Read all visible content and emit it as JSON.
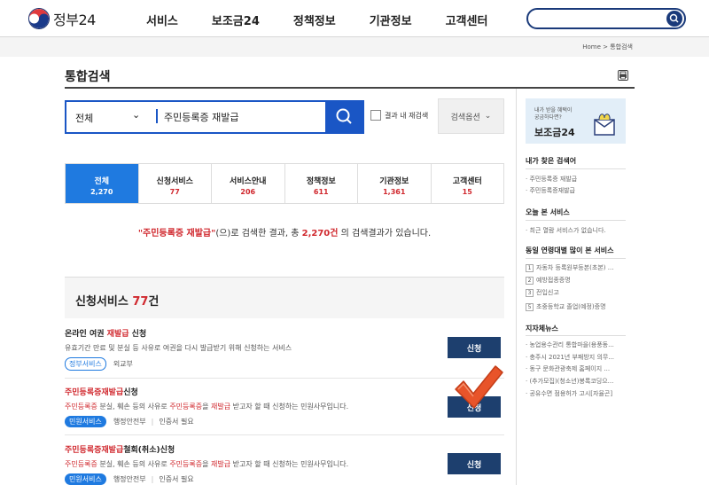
{
  "header": {
    "logo_text": "정부24",
    "menu": [
      "서비스",
      "보조금24",
      "정책정보",
      "기관정보",
      "고객센터"
    ],
    "search_placeholder": ""
  },
  "breadcrumb": {
    "home": "Home",
    "sep": ">",
    "current": "통합검색"
  },
  "page_title": "통합검색",
  "search": {
    "scope": "전체",
    "query": "주민등록증 재발급",
    "in_result_label": "결과 내 재검색",
    "options_label": "검색옵션"
  },
  "tabs": [
    {
      "label": "전체",
      "count": "2,270"
    },
    {
      "label": "신청서비스",
      "count": "77"
    },
    {
      "label": "서비스안내",
      "count": "206"
    },
    {
      "label": "정책정보",
      "count": "611"
    },
    {
      "label": "기관정보",
      "count": "1,361"
    },
    {
      "label": "고객센터",
      "count": "15"
    }
  ],
  "summary": {
    "keyword": "\"주민등록증 재발급\"",
    "mid": "(으)로 검색한 결과, 총 ",
    "count": "2,270건",
    "tail": " 의 검색결과가 있습니다."
  },
  "section": {
    "title": "신청서비스 ",
    "count": "77",
    "unit": "건"
  },
  "results": [
    {
      "title_pre": "온라인 여권 ",
      "title_hl": "재발급",
      "title_post": " 신청",
      "desc": "유효기간 만료 및 분실 등 사유로 여권을 다시 발급받기 위해 신청하는 서비스",
      "tag": "정부서비스",
      "org": "외교부",
      "cert": "",
      "button": "신청"
    },
    {
      "title_pre": "",
      "title_hl": "주민등록증재발급",
      "title_post": "신청",
      "desc_hl1": "주민등록증",
      "desc_mid1": " 분실, 훼손 등의 사유로 ",
      "desc_hl2": "주민등록증",
      "desc_mid2": "을 ",
      "desc_hl3": "재발급",
      "desc_tail": " 받고자 할 때 신청하는 민원사무입니다.",
      "tag": "민원서비스",
      "org": "행정안전부",
      "cert": "인증서 필요",
      "button": "신청"
    },
    {
      "title_pre": "",
      "title_hl": "주민등록증재발급",
      "title_post": "철회(취소)신청",
      "desc_hl1": "주민등록증",
      "desc_mid1": " 분실, 훼손 등의 사유로 ",
      "desc_hl2": "주민등록증",
      "desc_mid2": "을 ",
      "desc_hl3": "재발급",
      "desc_tail": " 받고자 할 때 신청하는 민원사무입니다.",
      "tag": "민원서비스",
      "org": "행정안전부",
      "cert": "인증서 필요",
      "button": "신청"
    }
  ],
  "sidebar": {
    "banner_line1": "내가 받을 혜택이",
    "banner_line2": "궁금하다면?",
    "banner_title": "보조금24",
    "recent_title": "내가 찾은 검색어",
    "recent": [
      "· 주민등록증 재발급",
      "· 주민등록증재발급"
    ],
    "today_title": "오늘 본 서비스",
    "today": [
      "· 최근 열람 서비스가 없습니다."
    ],
    "popular_title": "동일 연령대별 많이 본 서비스",
    "popular": [
      {
        "rank": "1",
        "text": "자동차 등록원부등본(초본) ..."
      },
      {
        "rank": "2",
        "text": "예방접종증명"
      },
      {
        "rank": "3",
        "text": "전입신고"
      },
      {
        "rank": "5",
        "text": "초중등학교 졸업(예정)증명"
      }
    ],
    "news_title": "지자체뉴스",
    "news": [
      "· 농업용수관리 통합마을(용풍동...",
      "· 충주시 2021년 부패방지 의무...",
      "· 동구 문화관광축제 홈페이지 ...",
      "· (추가모집)(청소년)봉록코딩으...",
      "· 공유수면 점용허가 고시[자율곤]"
    ]
  },
  "colors": {
    "accent": "#1f7ae0",
    "brand": "#1a56c5",
    "highlight": "#d0282e",
    "button": "#1d3f6e",
    "check": "#e8542a"
  }
}
